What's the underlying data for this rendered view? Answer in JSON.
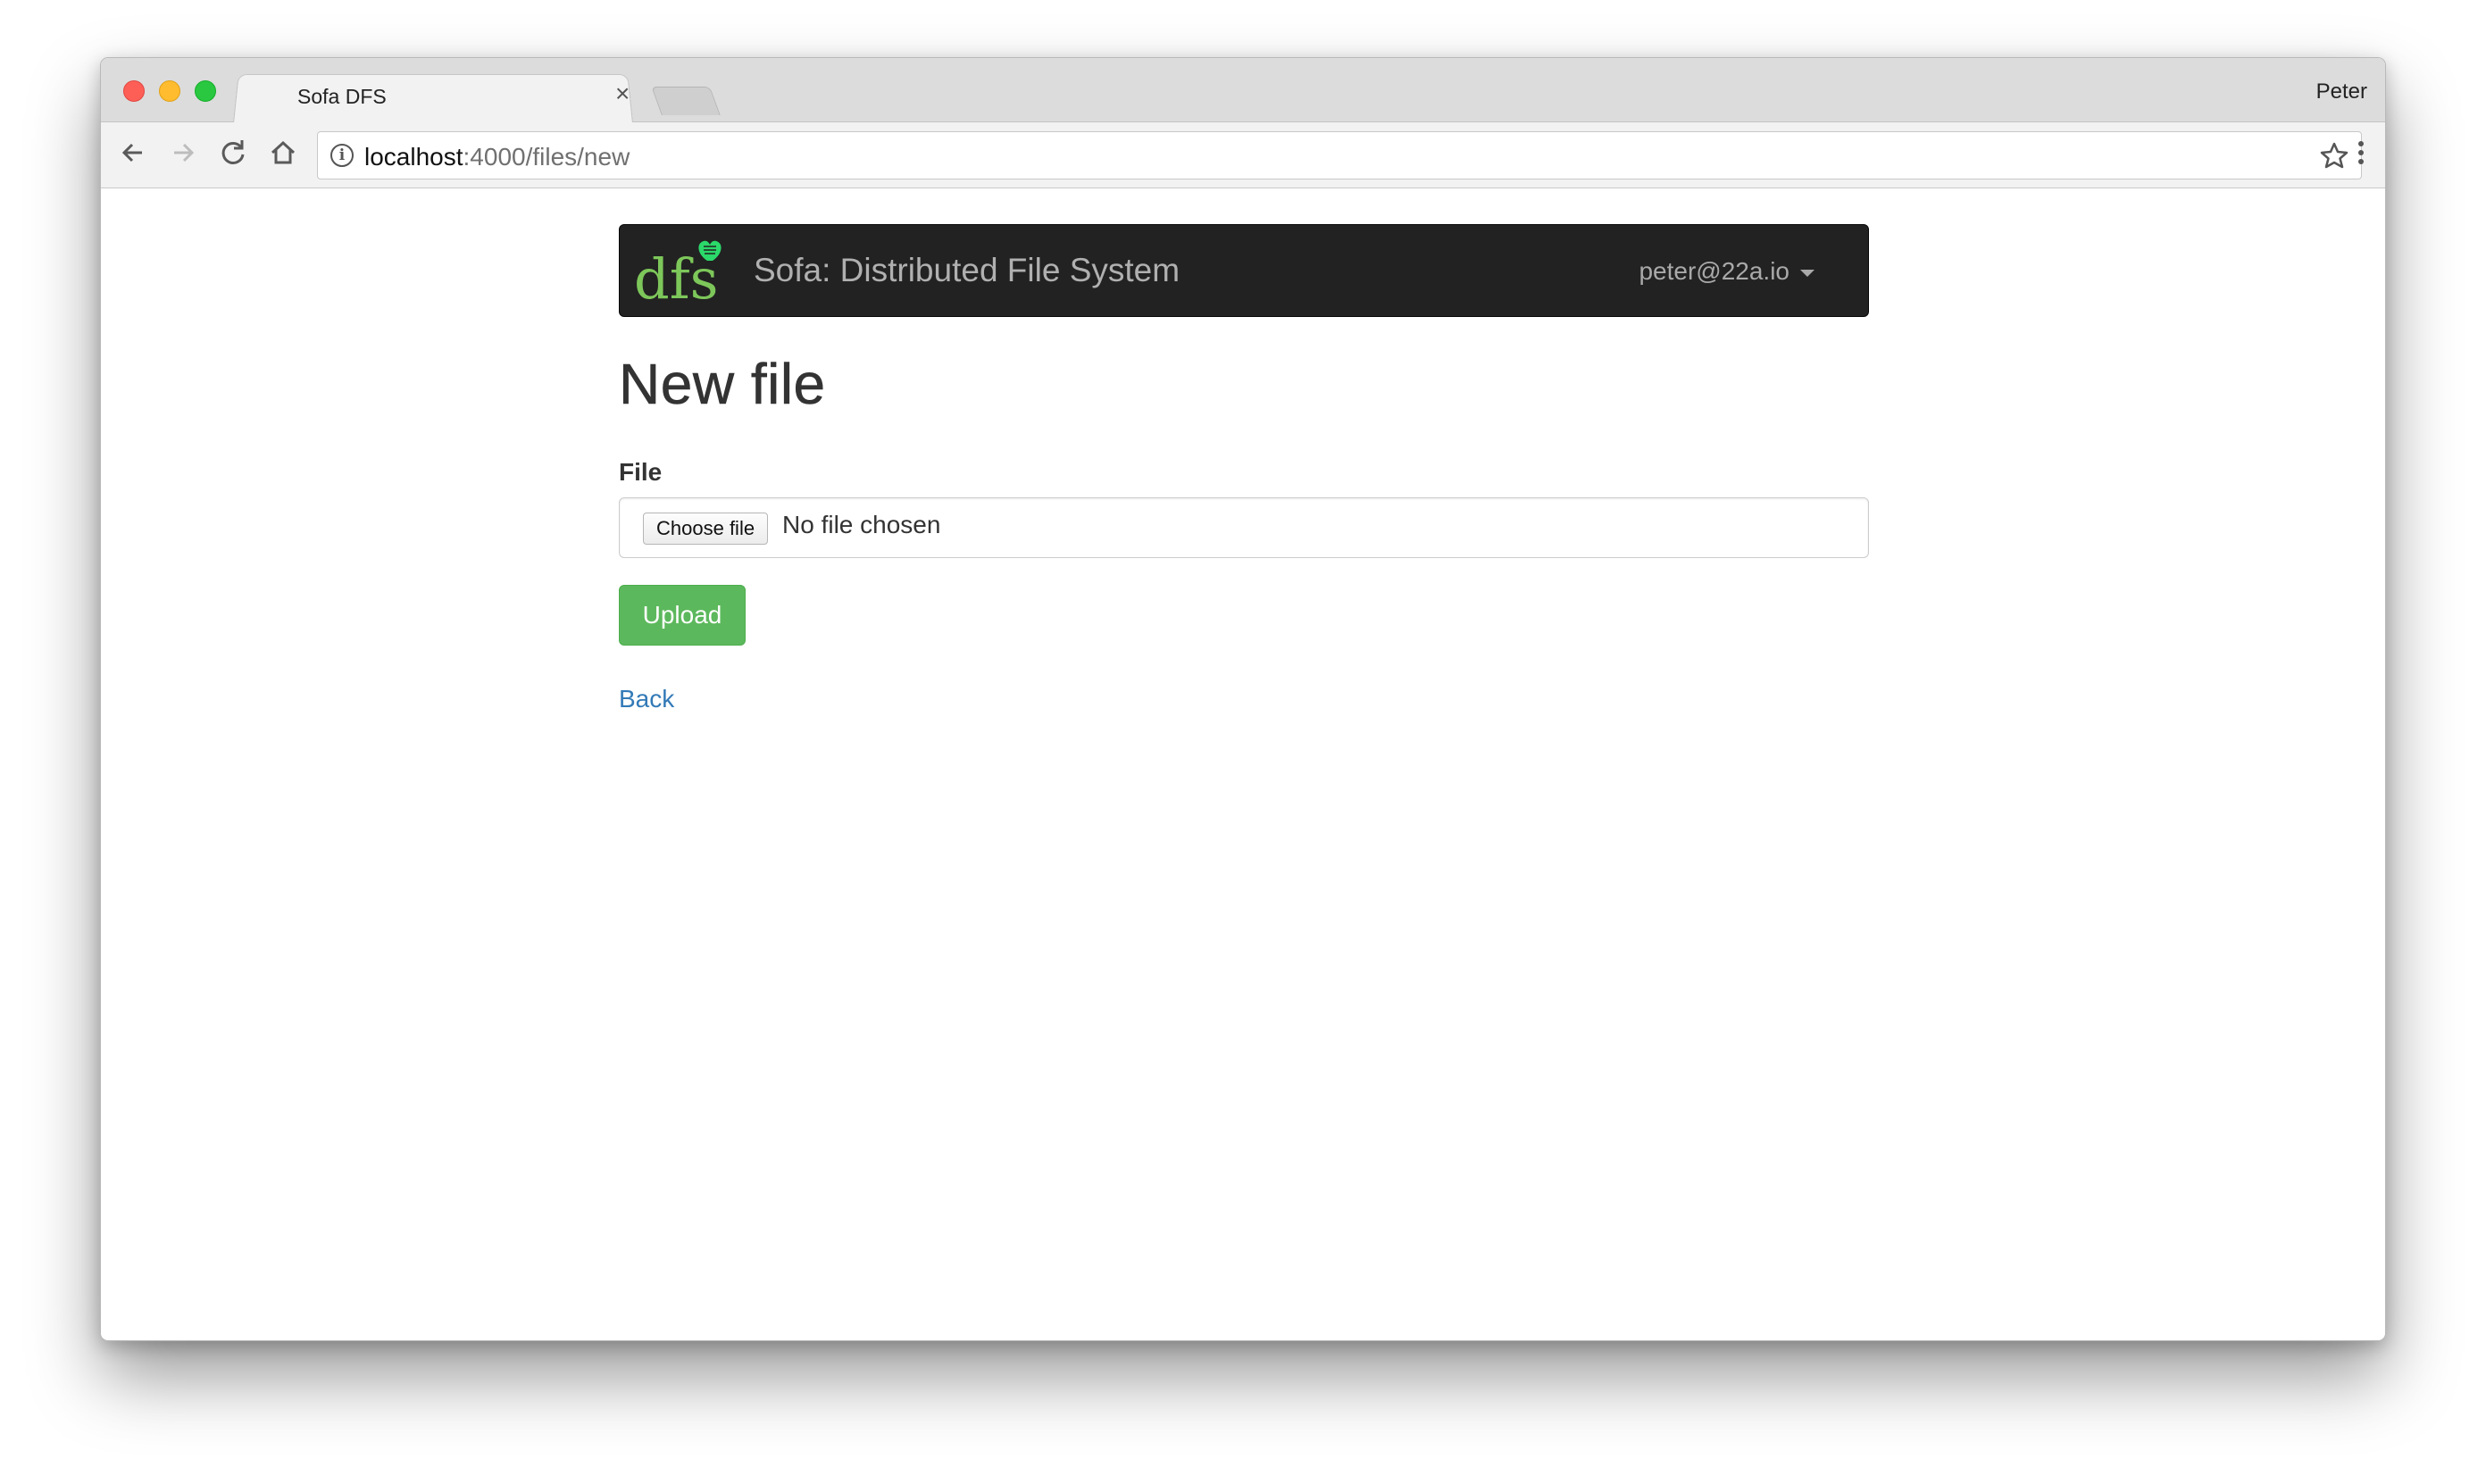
{
  "browser": {
    "tab_title": "Sofa DFS",
    "tab_close": "×",
    "profile_name": "Peter",
    "url_host": "localhost",
    "url_path": ":4000/files/new",
    "icons": {
      "back": "back-arrow-icon",
      "forward": "forward-arrow-icon",
      "reload": "reload-icon",
      "home": "home-icon",
      "info": "info-icon",
      "star": "star-icon",
      "menu": "menu-dots-icon"
    }
  },
  "navbar": {
    "logo_text": "dfs",
    "brand": "Sofa: Distributed File System",
    "user_email": "peter@22a.io",
    "colors": {
      "background": "#222222",
      "logo_green": "#7dc75a",
      "heart_green": "#2bd96a"
    }
  },
  "main": {
    "title": "New file",
    "file_label": "File",
    "choose_button": "Choose file",
    "file_status": "No file chosen",
    "upload_button": "Upload",
    "back_link": "Back",
    "colors": {
      "upload_bg": "#5cb85c",
      "link": "#337ab7"
    }
  }
}
